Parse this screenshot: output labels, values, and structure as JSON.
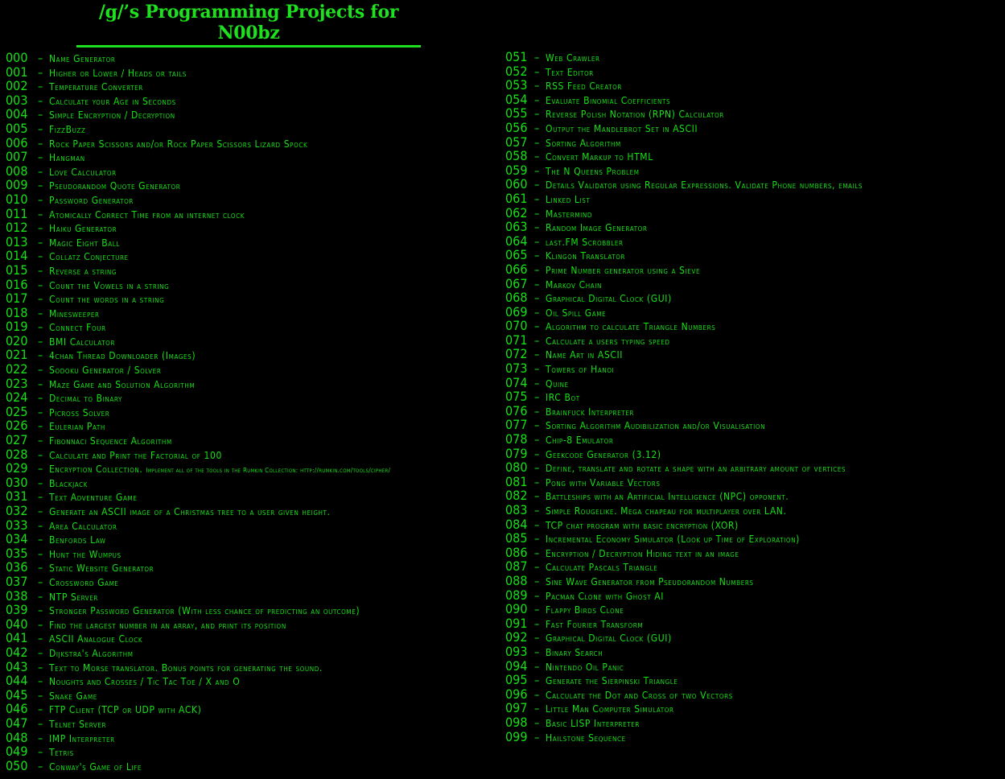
{
  "title": "/g/’s Programming Projects for N00bz",
  "left": [
    [
      "000",
      "Name Generator"
    ],
    [
      "001",
      "Higher or Lower / Heads or tails"
    ],
    [
      "002",
      "Temperature Converter"
    ],
    [
      "003",
      "Calculate your Age in Seconds"
    ],
    [
      "004",
      "Simple Encryption / Decryption"
    ],
    [
      "005",
      "FizzBuzz"
    ],
    [
      "006",
      "Rock Paper Scissors and/or Rock Paper Scissors Lizard Spock"
    ],
    [
      "007",
      "Hangman"
    ],
    [
      "008",
      "Love Calculator"
    ],
    [
      "009",
      "Pseudorandom Quote Generator"
    ],
    [
      "010",
      "Password Generator"
    ],
    [
      "011",
      "Atomically Correct Time from an internet clock"
    ],
    [
      "012",
      "Haiku Generator"
    ],
    [
      "013",
      "Magic Eight Ball"
    ],
    [
      "014",
      "Collatz Conjecture"
    ],
    [
      "015",
      "Reverse a string"
    ],
    [
      "016",
      "Count the Vowels in a string"
    ],
    [
      "017",
      "Count the words in a string"
    ],
    [
      "018",
      "Minesweeper"
    ],
    [
      "019",
      "Connect Four"
    ],
    [
      "020",
      "BMI Calculator"
    ],
    [
      "021",
      "4chan Thread Downloader (Images)"
    ],
    [
      "022",
      "Sodoku Generator / Solver"
    ],
    [
      "023",
      "Maze Game and Solution Algorithm"
    ],
    [
      "024",
      "Decimal to Binary"
    ],
    [
      "025",
      "Picross Solver"
    ],
    [
      "026",
      "Eulerian Path"
    ],
    [
      "027",
      "Fibonnaci Sequence Algorithm"
    ],
    [
      "028",
      "Calculate and Print the Factorial of 100"
    ],
    [
      "029",
      "Encryption Collection.",
      "Implement all of the tools in the Rumkin Collection: http://rumkin.com/tools/cipher/"
    ],
    [
      "030",
      "Blackjack"
    ],
    [
      "031",
      "Text Adventure Game"
    ],
    [
      "032",
      "Generate an ASCII image of a Christmas tree to a user given height."
    ],
    [
      "033",
      "Area Calculator"
    ],
    [
      "034",
      "Benfords Law"
    ],
    [
      "035",
      "Hunt the Wumpus"
    ],
    [
      "036",
      "Static Website Generator"
    ],
    [
      "037",
      "Crossword Game"
    ],
    [
      "038",
      "NTP Server"
    ],
    [
      "039",
      "Stronger Password Generator (With less chance of predicting an outcome)"
    ],
    [
      "040",
      "Find the largest number in an array, and print its position"
    ],
    [
      "041",
      "ASCII Analogue Clock"
    ],
    [
      "042",
      "Dijkstra's Algorithm"
    ],
    [
      "043",
      "Text to Morse translator. Bonus points for generating the sound."
    ],
    [
      "044",
      "Noughts and Crosses / Tic Tac Toe / X and O"
    ],
    [
      "045",
      "Snake Game"
    ],
    [
      "046",
      "FTP Client (TCP or UDP with ACK)"
    ],
    [
      "047",
      "Telnet Server"
    ],
    [
      "048",
      "IMP Interpreter"
    ],
    [
      "049",
      "Tetris"
    ],
    [
      "050",
      "Conway's Game of Life"
    ]
  ],
  "right": [
    [
      "051",
      "Web Crawler"
    ],
    [
      "052",
      "Text Editor"
    ],
    [
      "053",
      "RSS Feed Creator"
    ],
    [
      "054",
      "Evaluate Binomial Coefficients"
    ],
    [
      "055",
      "Reverse Polish Notation (RPN) Calculator"
    ],
    [
      "056",
      "Output the Mandlebrot Set in ASCII"
    ],
    [
      "057",
      "Sorting Algorithm"
    ],
    [
      "058",
      "Convert Markup to HTML"
    ],
    [
      "059",
      "The N Queens Problem"
    ],
    [
      "060",
      "Details Validator using Regular Expressions. Validate Phone numbers, emails"
    ],
    [
      "061",
      "Linked List"
    ],
    [
      "062",
      "Mastermind"
    ],
    [
      "063",
      "Random Image Generator"
    ],
    [
      "064",
      "last.FM Scrobbler"
    ],
    [
      "065",
      "Klingon Translator"
    ],
    [
      "066",
      "Prime Number generator using a Sieve"
    ],
    [
      "067",
      "Markov Chain"
    ],
    [
      "068",
      "Graphical Digital Clock (GUI)"
    ],
    [
      "069",
      "Oil Spill Game"
    ],
    [
      "070",
      "Algorithm to calculate Triangle Numbers"
    ],
    [
      "071",
      "Calculate a users typing speed"
    ],
    [
      "072",
      "Name Art in ASCII"
    ],
    [
      "073",
      "Towers of Hanoi"
    ],
    [
      "074",
      "Quine"
    ],
    [
      "075",
      "IRC Bot"
    ],
    [
      "076",
      "Brainfuck Interpreter"
    ],
    [
      "077",
      "Sorting Algorithm Audibilization and/or Visualisation"
    ],
    [
      "078",
      "Chip-8 Emulator"
    ],
    [
      "079",
      "Geekcode Generator (3.12)"
    ],
    [
      "080",
      "Define, translate and rotate a shape with an arbitrary amount of vertices"
    ],
    [
      "081",
      "Pong with Variable Vectors"
    ],
    [
      "082",
      "Battleships with an Artificial Intelligence (NPC) opponent."
    ],
    [
      "083",
      "Simple Rougelike. Mega chapeau for multiplayer over LAN."
    ],
    [
      "084",
      "TCP chat program with basic encryption (XOR)"
    ],
    [
      "085",
      "Incremental Economy Simulator (Look up Time of Exploration)"
    ],
    [
      "086",
      "Encryption / Decryption Hiding text in an image"
    ],
    [
      "087",
      "Calculate Pascals Triangle"
    ],
    [
      "088",
      "Sine Wave Generator from Pseudorandom Numbers"
    ],
    [
      "089",
      "Pacman Clone with Ghost AI"
    ],
    [
      "090",
      "Flappy Birds Clone"
    ],
    [
      "091",
      "Fast Fourier Transform"
    ],
    [
      "092",
      "Graphical Digital Clock (GUI)"
    ],
    [
      "093",
      "Binary Search"
    ],
    [
      "094",
      "Nintendo Oil Panic"
    ],
    [
      "095",
      "Generate the Sierpinski Triangle"
    ],
    [
      "096",
      "Calculate the Dot and Cross of two Vectors"
    ],
    [
      "097",
      "Little Man Computer Simulator"
    ],
    [
      "098",
      "Basic LISP Interpreter"
    ],
    [
      "099",
      "Hailstone Sequence"
    ]
  ],
  "separator": "–",
  "colors": {
    "background": "#000000",
    "text": "#16e016"
  }
}
